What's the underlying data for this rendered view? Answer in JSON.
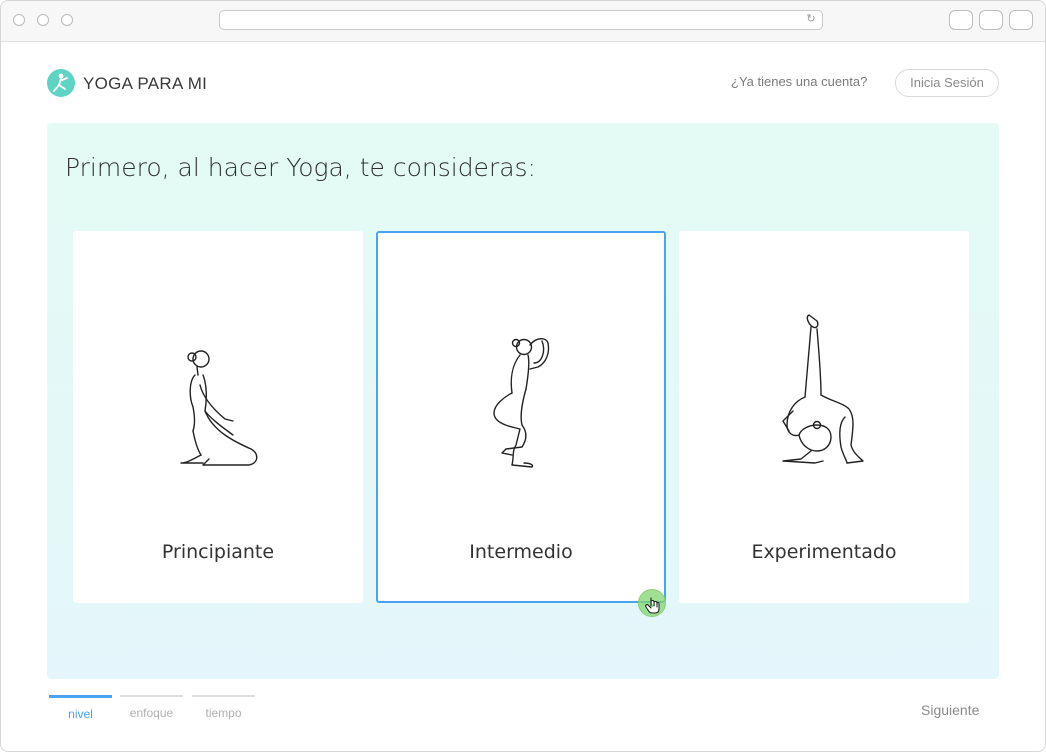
{
  "brand": {
    "name": "YOGA PARA MI",
    "icon": "yoga-logo-icon",
    "color": "#5fd3c4"
  },
  "header": {
    "has_account": "¿Ya tienes una cuenta?",
    "login_label": "Inicia Sesión"
  },
  "quiz": {
    "question": "Primero, al hacer Yoga, te consideras:",
    "options": [
      {
        "label": "Principiante",
        "icon": "kneeling-pose-icon",
        "selected": false
      },
      {
        "label": "Intermedio",
        "icon": "eagle-pose-icon",
        "selected": true
      },
      {
        "label": "Experimentado",
        "icon": "wheel-leg-raise-pose-icon",
        "selected": false
      }
    ]
  },
  "steps": [
    {
      "label": "nivel",
      "active": true
    },
    {
      "label": "enfoque",
      "active": false
    },
    {
      "label": "tiempo",
      "active": false
    }
  ],
  "footer": {
    "next_label": "Siguiente"
  },
  "colors": {
    "accent": "#4aa3f0",
    "panel_top": "#e3fbf4",
    "panel_bottom": "#e4f6fb",
    "cursor": "#82d66e"
  }
}
